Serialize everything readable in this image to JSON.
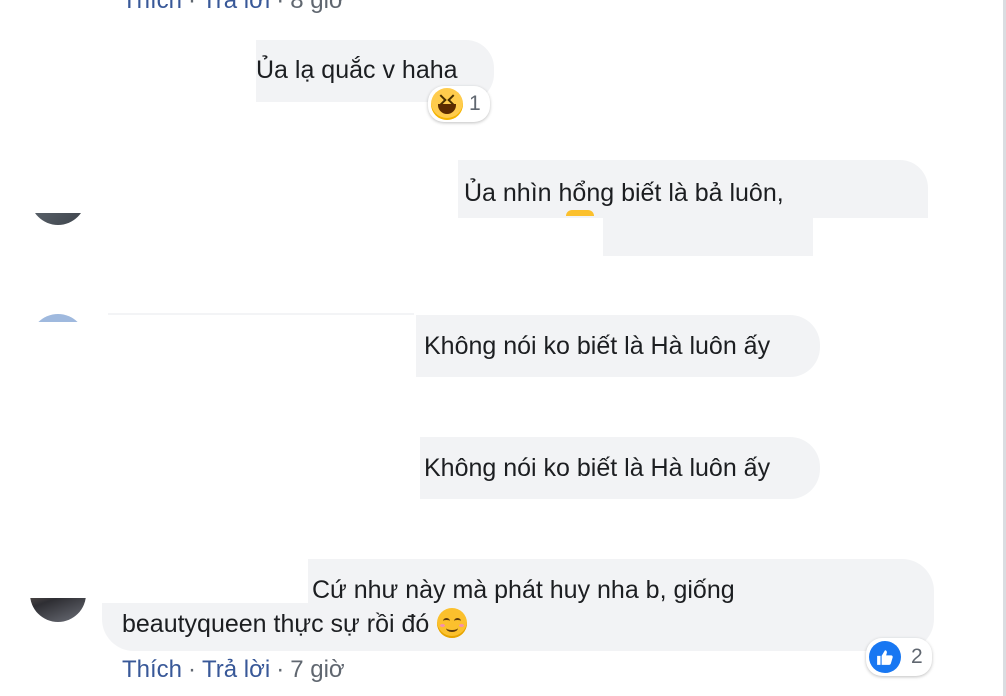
{
  "top_meta": {
    "like": "Thích",
    "reply": "Trả lời",
    "time": "8 giờ"
  },
  "comments": [
    {
      "text": "Ủa lạ quắc v haha",
      "reaction": {
        "icon": "haha-icon",
        "count": "1"
      }
    },
    {
      "text": "Ủa nhìn hổng biết là bả luôn,"
    },
    {
      "text": "Không nói ko biết là Hà luôn ấy"
    },
    {
      "text": "Không nói ko biết là Hà luôn ấy"
    },
    {
      "line1": "Cứ như này mà phát huy nha b, giống",
      "line2": "beautyqueen thực sự rồi đó",
      "emoji": "smiling-face-icon",
      "reaction": {
        "icon": "like-icon",
        "count": "2"
      }
    }
  ],
  "bottom_meta": {
    "like": "Thích",
    "reply": "Trả lời",
    "time": "7 giờ"
  },
  "colors": {
    "bubble": "#f2f3f5",
    "link": "#385898",
    "meta": "#606770",
    "like_blue": "#1877f2"
  }
}
